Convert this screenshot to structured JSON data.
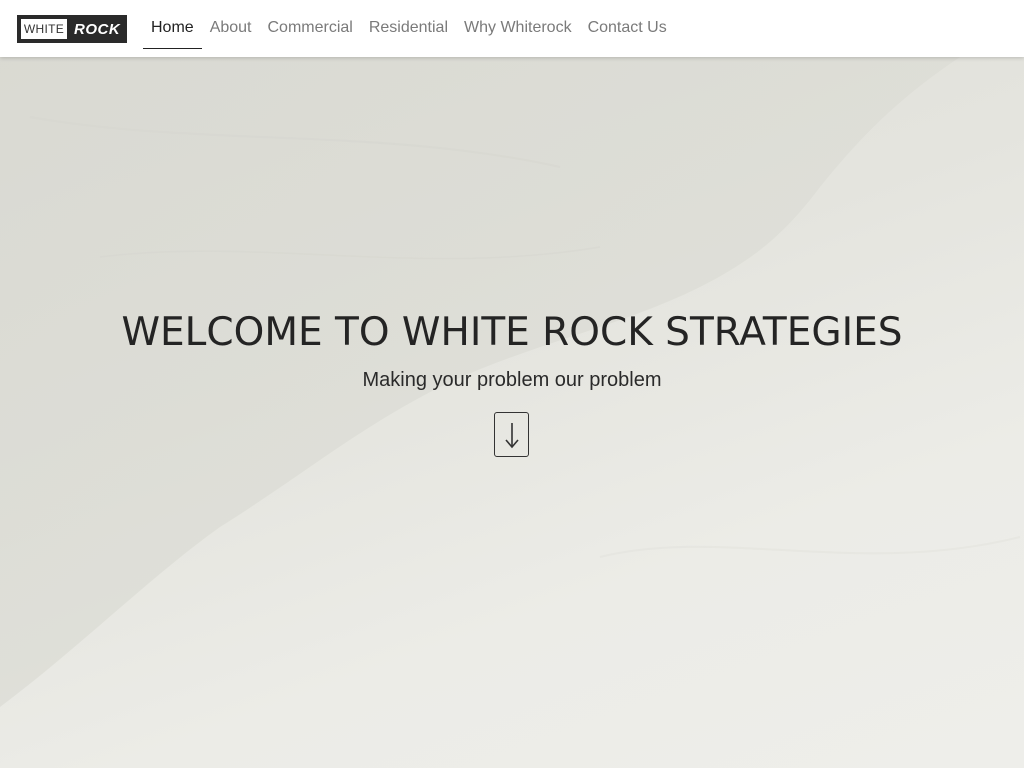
{
  "brand": {
    "logo_left": "WHITE",
    "logo_right": "ROCK"
  },
  "nav": {
    "items": [
      {
        "label": "Home",
        "active": true
      },
      {
        "label": "About",
        "active": false
      },
      {
        "label": "Commercial",
        "active": false
      },
      {
        "label": "Residential",
        "active": false
      },
      {
        "label": "Why Whiterock",
        "active": false
      },
      {
        "label": "Contact Us",
        "active": false
      }
    ]
  },
  "hero": {
    "title": "WELCOME TO WHITE ROCK STRATEGIES",
    "subtitle": "Making your problem our problem",
    "scroll_icon": "arrow-down-icon"
  },
  "colors": {
    "text_dark": "#242424",
    "nav_inactive": "#7a7a7a",
    "logo_bg": "#2a2a2a"
  }
}
